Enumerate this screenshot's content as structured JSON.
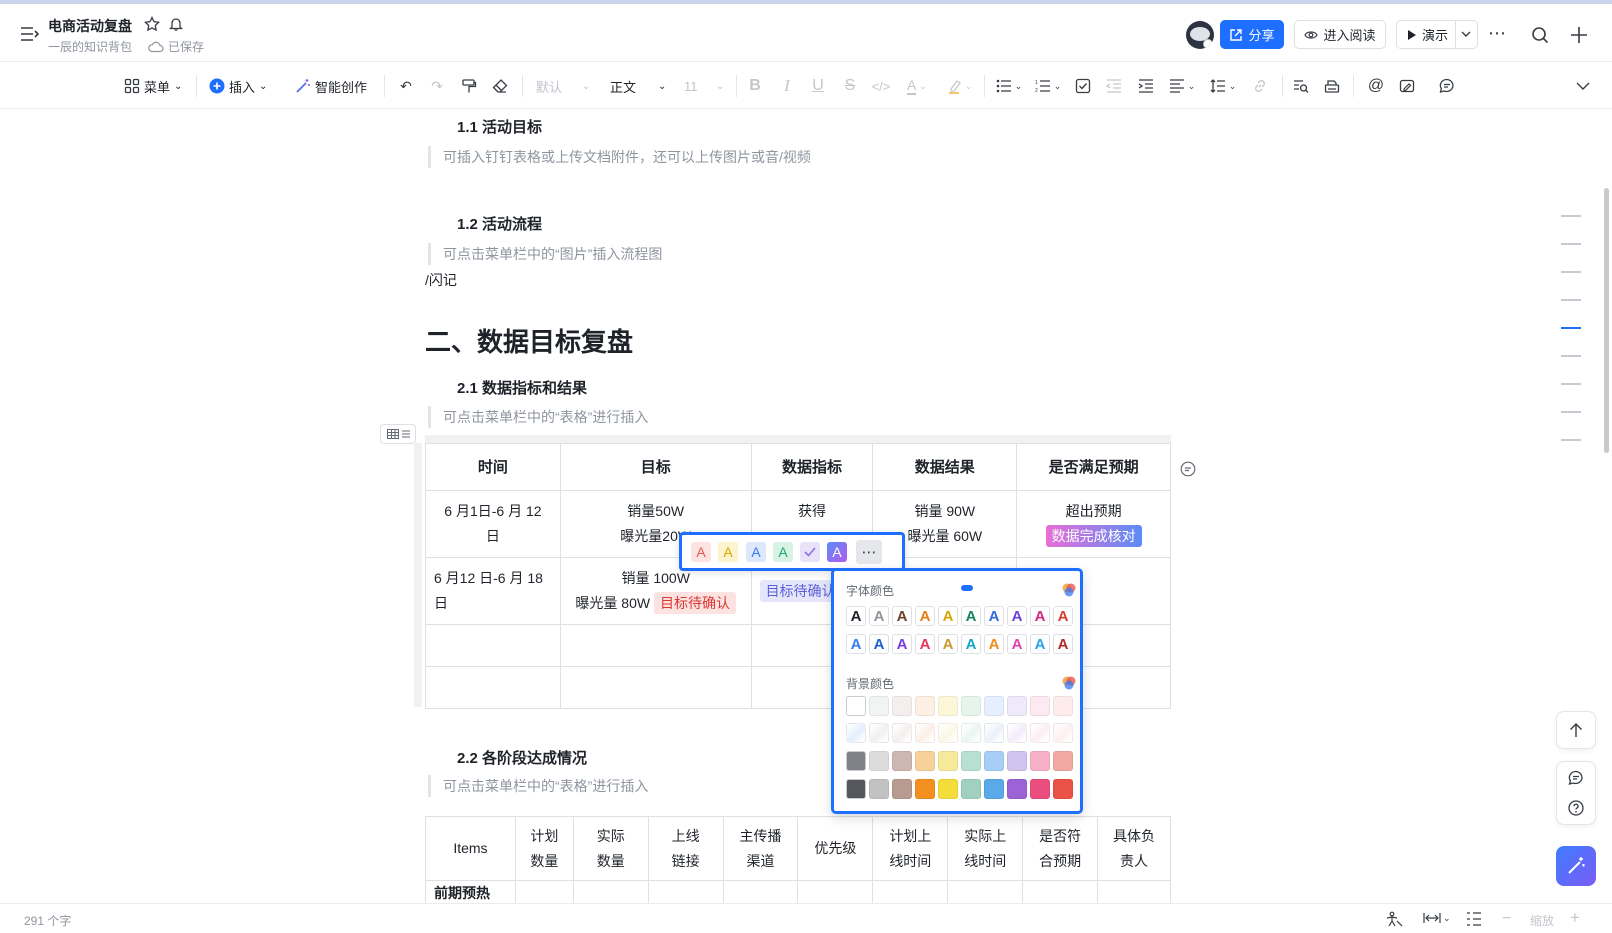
{
  "header": {
    "title": "电商活动复盘",
    "subtitle": "一辰的知识背包",
    "saved": "已保存",
    "share_label": "分享",
    "read_label": "进入阅读",
    "present_label": "演示"
  },
  "toolbar": {
    "menu_label": "菜单",
    "insert_label": "插入",
    "ai_label": "智能创作",
    "font_label": "默认",
    "style_label": "正文",
    "size_label": "11"
  },
  "doc": {
    "h_1_1": "1.1 活动目标",
    "q_1_1": "可插入钉钉表格或上传文档附件，还可以上传图片或音/视频",
    "h_1_2": "1.2 活动流程",
    "q_1_2": "可点击菜单栏中的“图片”插入流程图",
    "flash": "/闪记",
    "h2": "二、数据目标复盘",
    "h_2_1": "2.1 数据指标和结果",
    "q_2_1": "可点击菜单栏中的“表格”进行插入",
    "h_2_2": "2.2 各阶段达成情况",
    "q_2_2": "可点击菜单栏中的“表格”进行插入"
  },
  "table1": {
    "headers": [
      "时间",
      "目标",
      "数据指标",
      "数据结果",
      "是否满足预期"
    ],
    "r1": {
      "time_a": "6 月1日-6 月 12",
      "time_b": "日",
      "goal_a": "销量50W",
      "goal_b": "曝光量20W",
      "metric": "获得",
      "result_a": "销量 90W",
      "result_b": "曝光量 60W",
      "expect": "超出预期",
      "expect_tag": "数据完成核对"
    },
    "r2": {
      "time_a": "6 月12 日-6 月 18",
      "time_b": "日",
      "goal_a": "销量 100W",
      "goal_b": "曝光量 80W",
      "goal_tag": "目标待确认",
      "metric_tag": "目标待确认"
    }
  },
  "table2": {
    "headers": [
      "Items",
      "计划\n数量",
      "实际\n数量",
      "上线\n链接",
      "主传播\n渠道",
      "优先级",
      "计划上\n线时间",
      "实际上\n线时间",
      "是否符\n合预期",
      "具体负\n责人"
    ],
    "first_row": "前期预热"
  },
  "color_panel": {
    "font_color_label": "字体颜色",
    "bg_color_label": "背景颜色",
    "glyph": "A",
    "font_row1": [
      "#1f2329",
      "#8f959e",
      "#6f3f2a",
      "#e87d13",
      "#d8a400",
      "#17865f",
      "#2e6ce0",
      "#6a3fd8",
      "#d42780",
      "#d83931"
    ],
    "font_row2": [
      "#3a7bf0",
      "#1e5fd6",
      "#7b3ce0",
      "#e8335a",
      "#c99a2e",
      "#14a6c9",
      "#f08c1a",
      "#e03eb1",
      "#2fa3e8",
      "#b2292b"
    ],
    "bg_row1": [
      "#ffffff",
      "#f2f3f5",
      "#f4eeee",
      "#fdf0e2",
      "#fdf7da",
      "#e6f5ec",
      "#e6efff",
      "#eee9fb",
      "#fde9f0",
      "#fdecea"
    ],
    "bg_row2": [
      "#e3eefd",
      "#f0f0f0",
      "#f5eeee",
      "#fcefe5",
      "#fbf6e5",
      "#eaf5ef",
      "#eaf0fc",
      "#f2ecfb",
      "#fceef3",
      "#fcefef"
    ],
    "bg_row3": [
      "#7f8186",
      "#dcdcdc",
      "#cdb7b0",
      "#f8d09a",
      "#f7e99a",
      "#b7dfd2",
      "#a6cef7",
      "#d1c3ed",
      "#f6b0c7",
      "#f1a8a2"
    ],
    "bg_row4": [
      "#55575c",
      "#c2c2c2",
      "#b79b90",
      "#f39020",
      "#f4dc3a",
      "#a0d0c0",
      "#5aa9e8",
      "#9b63d6",
      "#ea4e7f",
      "#ea5247"
    ]
  },
  "quick_colors": [
    "#e8574f",
    "#d8a400",
    "#3a7bf0",
    "#1aa874",
    "#8d6fe0",
    "#3a7bf0"
  ],
  "footer": {
    "word_count": "291 个字",
    "zoom_label": "缩放"
  }
}
